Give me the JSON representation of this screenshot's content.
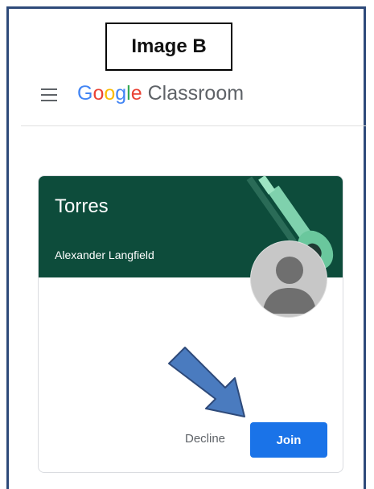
{
  "label": {
    "text": "Image B"
  },
  "header": {
    "menu_icon": "hamburger-menu-icon",
    "brand_google": [
      "G",
      "o",
      "o",
      "g",
      "l",
      "e"
    ],
    "brand_product": "Classroom"
  },
  "card": {
    "course_name": "Torres",
    "teacher_name": "Alexander Langfield",
    "decline_label": "Decline",
    "join_label": "Join",
    "banner_color": "#0d4c3b",
    "join_color": "#1a73e8"
  },
  "annotation": {
    "arrow_color": "#4a7bbf",
    "arrow_icon": "arrow-down-right-icon"
  },
  "colors": {
    "frame": "#2e4a7a"
  }
}
